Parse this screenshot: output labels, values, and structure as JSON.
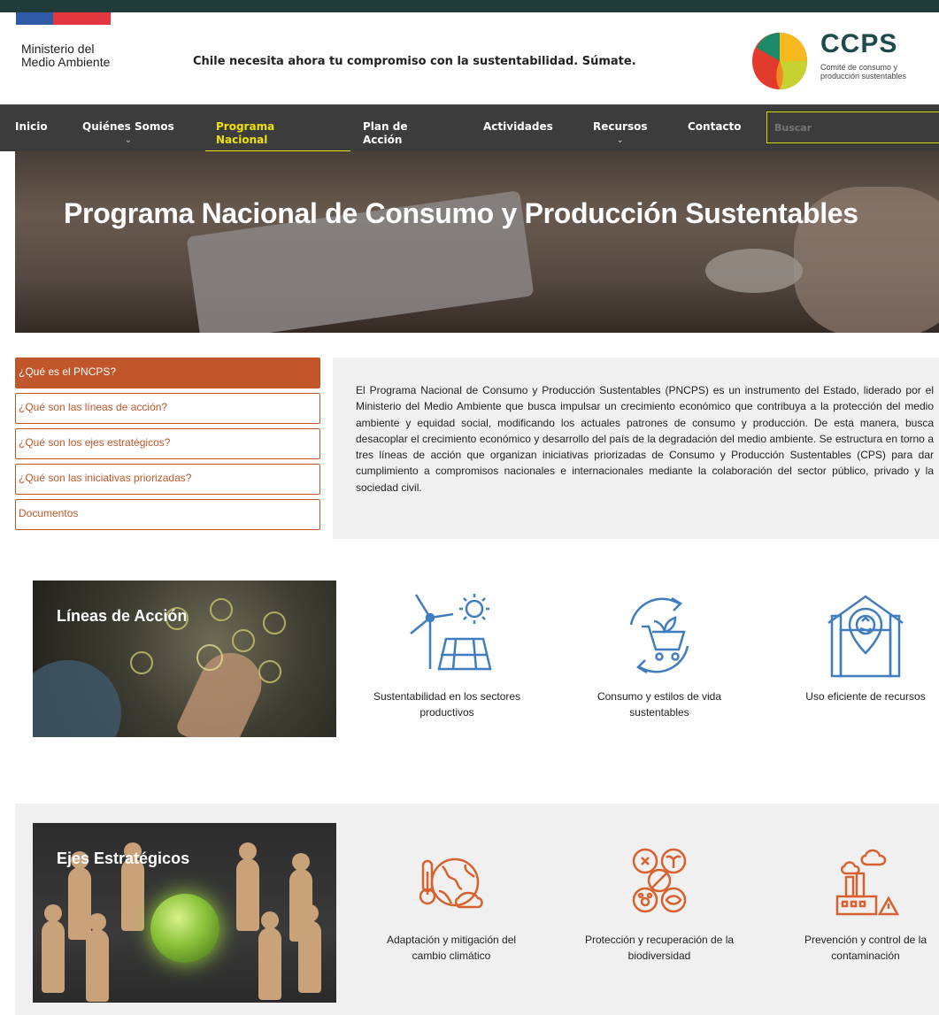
{
  "header": {
    "ministry": "Ministerio del Medio Ambiente",
    "tagline": "Chile necesita ahora tu compromiso con la sustentabilidad. Súmate.",
    "logo_title": "CCPS",
    "logo_subtitle": "Comité de consumo y producción sustentables"
  },
  "nav": {
    "items": [
      {
        "label": "Inicio"
      },
      {
        "label": "Quiénes Somos"
      },
      {
        "label": "Programa Nacional"
      },
      {
        "label": "Plan de Acción"
      },
      {
        "label": "Actividades"
      },
      {
        "label": "Recursos"
      },
      {
        "label": "Contacto"
      }
    ],
    "chevron": "⌄",
    "search_placeholder": "Buscar"
  },
  "hero": {
    "title": "Programa Nacional de Consumo y Producción Sustentables"
  },
  "side_menu": [
    {
      "label": "¿Qué es el PNCPS?"
    },
    {
      "label": "¿Qué son las líneas de acción?"
    },
    {
      "label": "¿Qué son los ejes estratégicos?"
    },
    {
      "label": "¿Qué son las iniciativas priorizadas?"
    },
    {
      "label": "Documentos"
    }
  ],
  "intro": "El Programa Nacional de Consumo y Producción Sustentables (PNCPS) es un instrumento del Estado, liderado por el Ministerio del Medio Ambiente que busca impulsar un crecimiento económico que contribuya a la protección del medio ambiente y equidad social, modificando los actuales patrones de consumo y producción. De esta manera, busca desacoplar el crecimiento económico y desarrollo del país de la degradación del medio ambiente. Se estructura en torno a tres líneas de acción que organizan iniciativas priorizadas de Consumo y Producción Sustentables (CPS) para dar cumplimiento a compromisos nacionales e internacionales mediante la colaboración del sector público, privado y la sociedad civil.",
  "lineas": {
    "title": "Líneas de Acción",
    "items": [
      {
        "label": "Sustentabilidad en los sectores productivos",
        "icon": "wind-solar-icon"
      },
      {
        "label": "Consumo y estilos de vida sustentables",
        "icon": "cart-cycle-icon"
      },
      {
        "label": "Uso eficiente de recursos",
        "icon": "house-recycle-icon"
      }
    ],
    "color": "#3f7dbf"
  },
  "ejes": {
    "title": "Ejes Estratégicos",
    "items": [
      {
        "label": "Adaptación y mitigación del cambio climático",
        "icon": "climate-globe-icon"
      },
      {
        "label": "Protección y recuperación de la biodiversidad",
        "icon": "biodiversity-icon"
      },
      {
        "label": "Prevención y control de la contaminación",
        "icon": "factory-pollution-icon"
      }
    ],
    "color": "#d8622f"
  }
}
